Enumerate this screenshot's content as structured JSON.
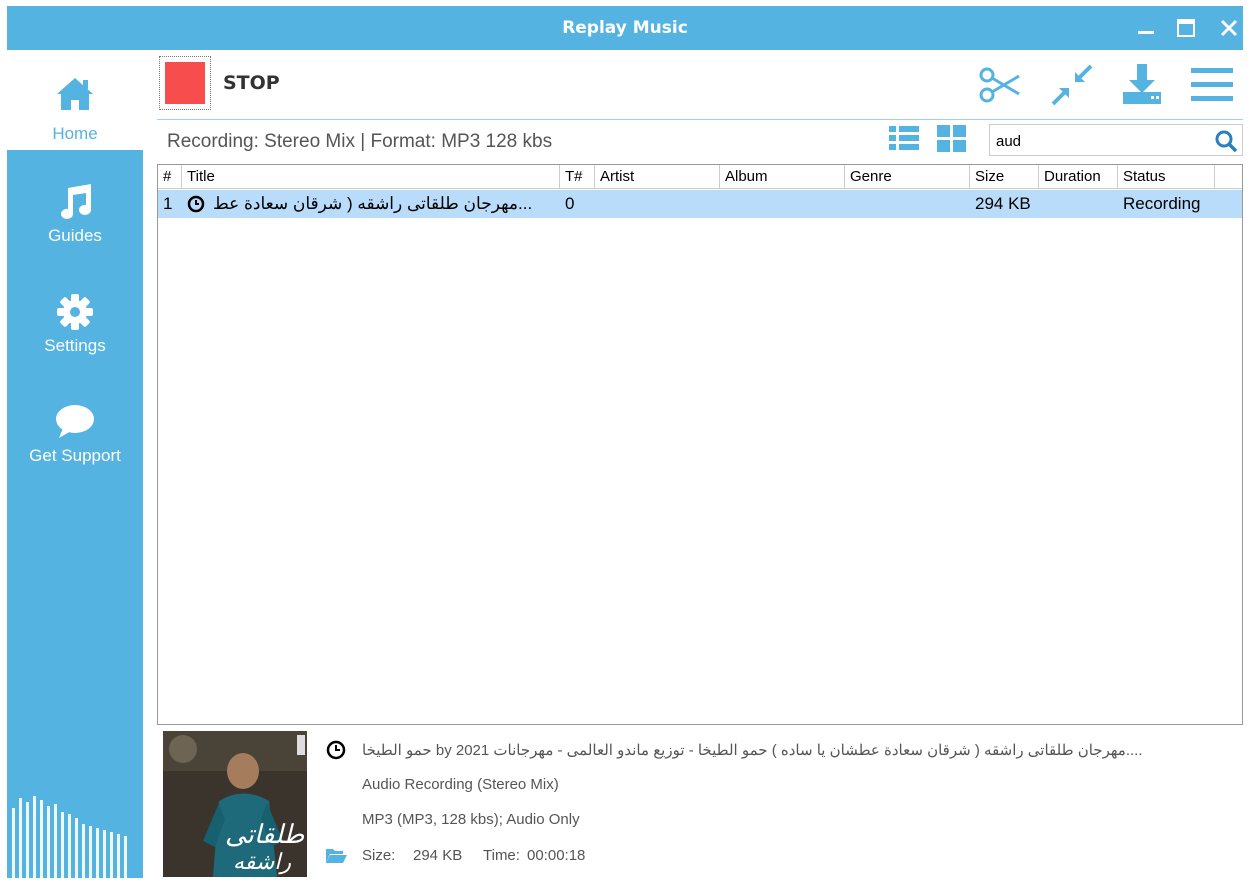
{
  "app": {
    "title": "Replay Music"
  },
  "window_controls": {
    "minimize": "minimize-icon",
    "maximize": "maximize-icon",
    "close": "close-icon"
  },
  "sidebar": {
    "items": [
      {
        "label": "Home",
        "icon": "home-icon",
        "active": true
      },
      {
        "label": "Guides",
        "icon": "music-note-icon"
      },
      {
        "label": "Settings",
        "icon": "gear-icon"
      },
      {
        "label": "Get Support",
        "icon": "chat-bubble-icon"
      }
    ]
  },
  "toolbar": {
    "stop_label": "STOP",
    "icons": [
      "scissors-icon",
      "shrink-icon",
      "download-icon",
      "menu-icon"
    ]
  },
  "info": {
    "text": "Recording: Stereo Mix | Format: MP3 128 kbs",
    "search_value": "aud"
  },
  "table": {
    "columns": [
      "#",
      "Title",
      "T#",
      "Artist",
      "Album",
      "Genre",
      "Size",
      "Duration",
      "Status"
    ],
    "rows": [
      {
        "num": "1",
        "title": "مهرجان طلقاتى راشقه ( شرقان سعادة عط...",
        "track": "0",
        "artist": "",
        "album": "",
        "genre": "",
        "size": "294 KB",
        "duration": "",
        "status": "Recording"
      }
    ]
  },
  "details": {
    "line1": "حمو الطيخا by مهرجان طلقاتى راشقه ( شرقان سعادة عطشان يا ساده ) حمو الطيخا - توزيع ماندو العالمى - مهرجانات 2021....",
    "line2": "Audio Recording (Stereo Mix)",
    "line3": "MP3 (MP3, 128 kbs); Audio Only",
    "size_label": "Size:",
    "size_value": "294 KB",
    "time_label": "Time:",
    "time_value": "00:00:18"
  },
  "colors": {
    "accent": "#55b3e1",
    "stop": "#f84d4d",
    "selected_row": "#b8dcfa"
  }
}
